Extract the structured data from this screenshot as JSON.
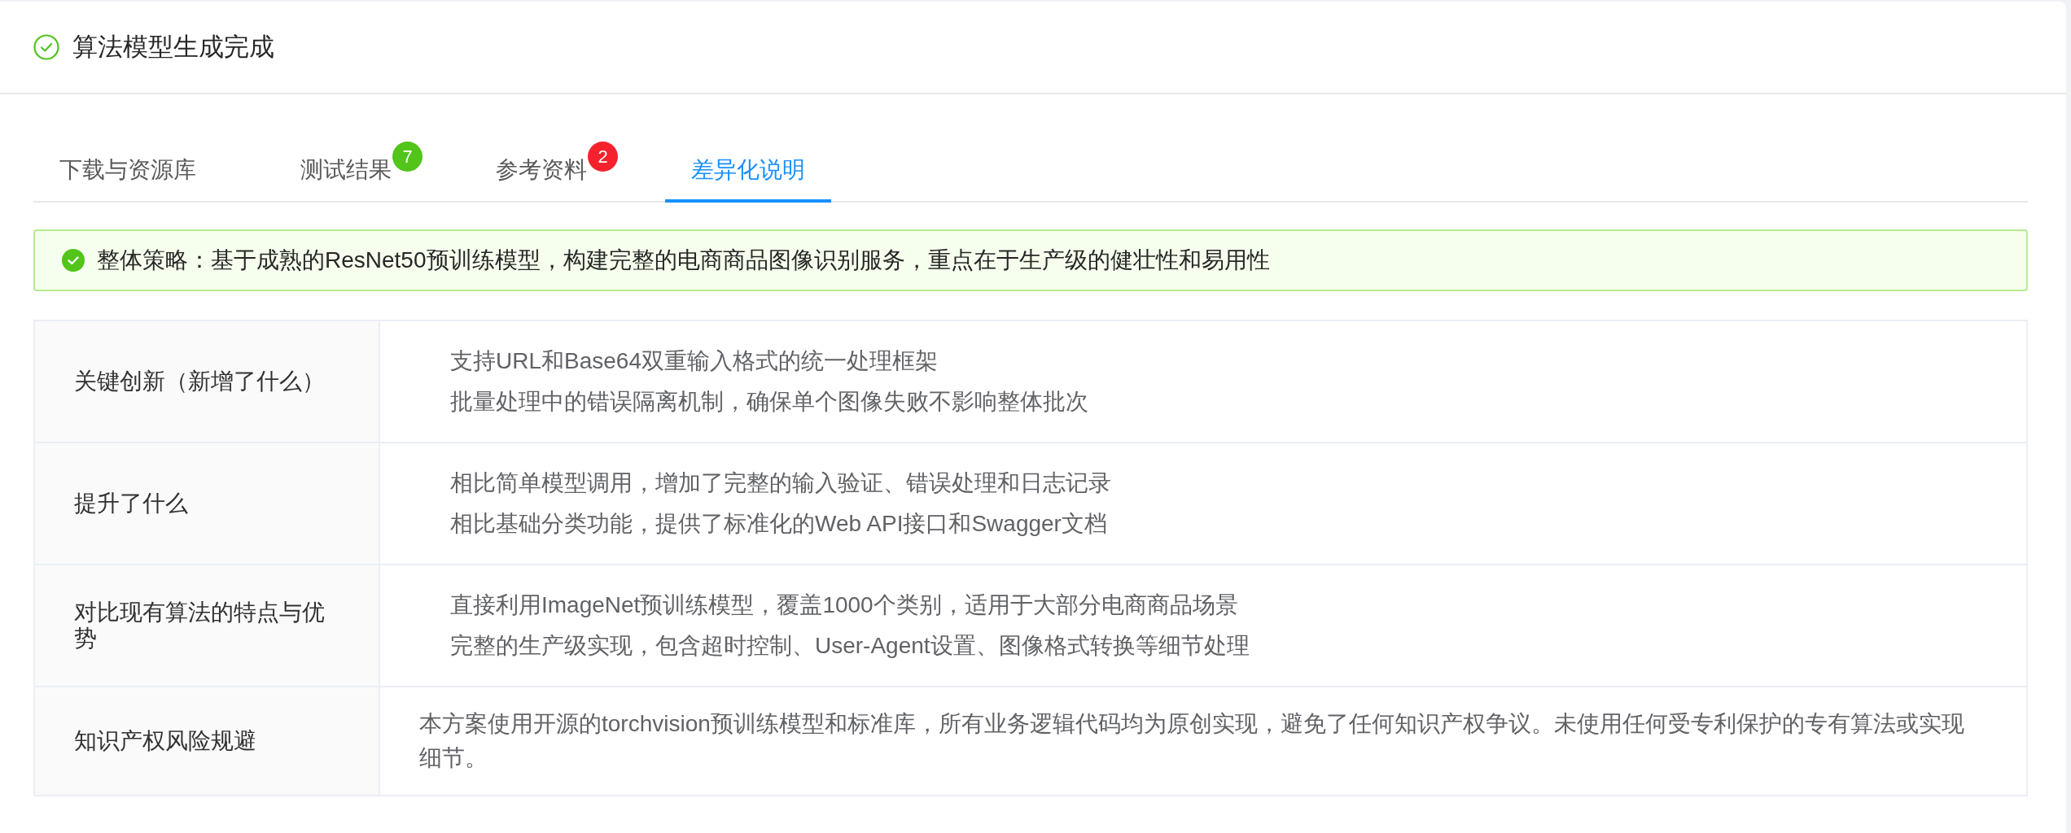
{
  "header": {
    "title": "算法模型生成完成"
  },
  "tabs": [
    {
      "label": "下载与资源库",
      "selected": false
    },
    {
      "label": "测试结果",
      "selected": false,
      "badge": {
        "count": "7",
        "color": "#52c41a"
      }
    },
    {
      "label": "参考资料",
      "selected": false,
      "badge": {
        "count": "2",
        "color": "#f5222d"
      }
    },
    {
      "label": "差异化说明",
      "selected": true
    }
  ],
  "alert": {
    "text": "整体策略：基于成熟的ResNet50预训练模型，构建完整的电商商品图像识别服务，重点在于生产级的健壮性和易用性"
  },
  "table": {
    "rows": [
      {
        "kind": "list",
        "label": "关键创新（新增了什么）",
        "items": [
          "支持URL和Base64双重输入格式的统一处理框架",
          "批量处理中的错误隔离机制，确保单个图像失败不影响整体批次"
        ]
      },
      {
        "kind": "list",
        "label": "提升了什么",
        "items": [
          "相比简单模型调用，增加了完整的输入验证、错误处理和日志记录",
          "相比基础分类功能，提供了标准化的Web API接口和Swagger文档"
        ]
      },
      {
        "kind": "list",
        "label": "对比现有算法的特点与优势",
        "items": [
          "直接利用ImageNet预训练模型，覆盖1000个类别，适用于大部分电商商品场景",
          "完整的生产级实现，包含超时控制、User-Agent设置、图像格式转换等细节处理"
        ]
      },
      {
        "kind": "text",
        "label": "知识产权风险规避",
        "text": "本方案使用开源的torchvision预训练模型和标准库，所有业务逻辑代码均为原创实现，避免了任何知识产权争议。未使用任何受专利保护的专有算法或实现细节。"
      }
    ]
  }
}
